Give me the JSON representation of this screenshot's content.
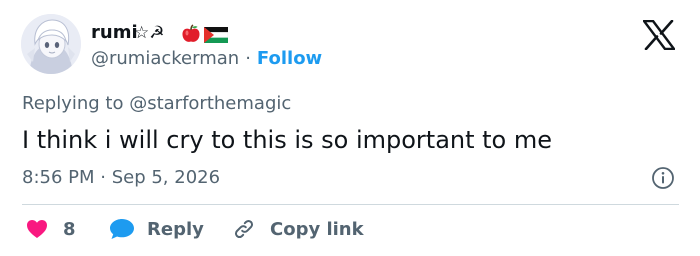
{
  "tweet": {
    "author": {
      "display_name": "rumi",
      "name_decorations": "☆☭",
      "handle": "@rumiackerman",
      "avatar_icon": "anime-avatar-icon"
    },
    "follow_label": "Follow",
    "separator": "·",
    "reply_prefix": "Replying to",
    "reply_to_handle": "@starforthemagic",
    "text": "I think i will cry to this is so important to me",
    "timestamp": "8:56 PM · Sep 5, 2026",
    "likes_count": "8",
    "reply_label": "Reply",
    "copy_link_label": "Copy link"
  },
  "icons": {
    "platform": "x-logo-icon",
    "info": "info-icon",
    "like": "heart-icon",
    "reply": "speech-bubble-icon",
    "copy_link": "link-icon",
    "name_emoji": [
      "apple-emoji",
      "palestine-flag-emoji"
    ]
  },
  "colors": {
    "link_blue": "#1d9bf0",
    "text_primary": "#0f1419",
    "text_secondary": "#536471",
    "like_red": "#f91880",
    "divider": "#cfd9de"
  }
}
